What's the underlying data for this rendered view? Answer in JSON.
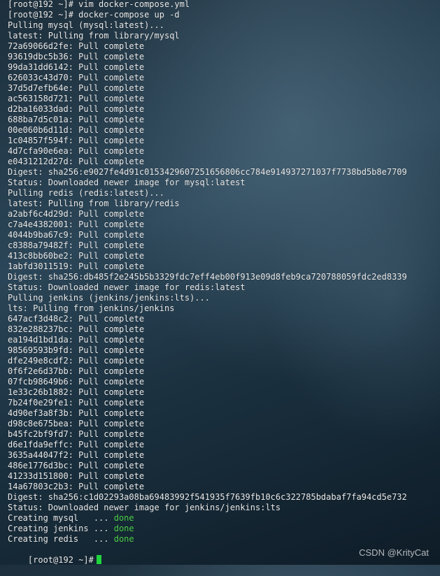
{
  "terminal": {
    "lines": [
      "[root@192 ~]# vim docker-compose.yml",
      "[root@192 ~]# docker-compose up -d",
      "Pulling mysql (mysql:latest)...",
      "latest: Pulling from library/mysql",
      "72a69066d2fe: Pull complete",
      "93619dbc5b36: Pull complete",
      "99da31dd6142: Pull complete",
      "626033c43d70: Pull complete",
      "37d5d7efb64e: Pull complete",
      "ac563158d721: Pull complete",
      "d2ba16033dad: Pull complete",
      "688ba7d5c01a: Pull complete",
      "00e060b6d11d: Pull complete",
      "1c04857f594f: Pull complete",
      "4d7cfa90e6ea: Pull complete",
      "e0431212d27d: Pull complete",
      "Digest: sha256:e9027fe4d91c0153429607251656806cc784e914937271037f7738bd5b8e7709",
      "Status: Downloaded newer image for mysql:latest",
      "Pulling redis (redis:latest)...",
      "latest: Pulling from library/redis",
      "a2abf6c4d29d: Pull complete",
      "c7a4e4382001: Pull complete",
      "4044b9ba67c9: Pull complete",
      "c8388a79482f: Pull complete",
      "413c8bb60be2: Pull complete",
      "1abfd3011519: Pull complete",
      "Digest: sha256:db485f2e245b5b3329fdc7eff4eb00f913e09d8feb9ca720788059fdc2ed8339",
      "Status: Downloaded newer image for redis:latest",
      "Pulling jenkins (jenkins/jenkins:lts)...",
      "lts: Pulling from jenkins/jenkins",
      "647acf3d48c2: Pull complete",
      "832e288237bc: Pull complete",
      "ea194d1bd1da: Pull complete",
      "98569593b9fd: Pull complete",
      "dfe249e8cdf2: Pull complete",
      "0f6f2e6d37bb: Pull complete",
      "07fcb98649b6: Pull complete",
      "1e33c26b1882: Pull complete",
      "7b24f0e29fe1: Pull complete",
      "4d90ef3a8f3b: Pull complete",
      "d98c8e675bea: Pull complete",
      "b45fc2bf9fd7: Pull complete",
      "d6e1fda9effc: Pull complete",
      "3635a44047f2: Pull complete",
      "486e1776d3bc: Pull complete",
      "41233d151800: Pull complete",
      "14a67803c2b3: Pull complete",
      "Digest: sha256:c1d02293a08ba69483992f541935f7639fb10c6c322785bdabaf7fa94cd5e732",
      "Status: Downloaded newer image for jenkins/jenkins:lts"
    ],
    "creating": [
      {
        "prefix": "Creating mysql   ... ",
        "status": "done"
      },
      {
        "prefix": "Creating jenkins ... ",
        "status": "done"
      },
      {
        "prefix": "Creating redis   ... ",
        "status": "done"
      }
    ],
    "prompt": "[root@192 ~]#"
  },
  "watermark": "CSDN @KrityCat",
  "colors": {
    "text": "#ebebeb",
    "done": "#4ed14e",
    "cursor": "#1fd33c"
  }
}
